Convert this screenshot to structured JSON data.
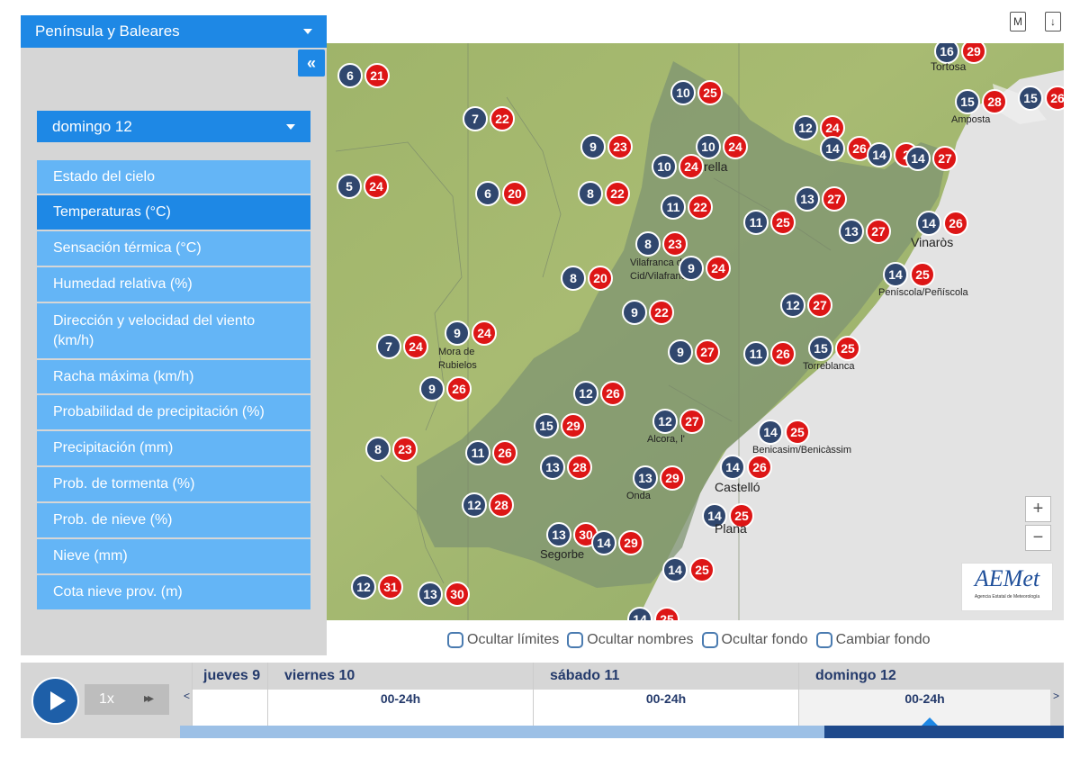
{
  "region": {
    "selected": "Península y Baleares"
  },
  "collapse_label": "«",
  "day_selector": {
    "selected": "domingo 12"
  },
  "menu": [
    {
      "label": "Estado del cielo",
      "active": false
    },
    {
      "label": "Temperaturas (°C)",
      "active": true
    },
    {
      "label": "Sensación térmica (°C)",
      "active": false
    },
    {
      "label": "Humedad relativa (%)",
      "active": false
    },
    {
      "label": "Dirección y velocidad del viento (km/h)",
      "active": false
    },
    {
      "label": "Racha máxima (km/h)",
      "active": false
    },
    {
      "label": "Probabilidad de precipitación (%)",
      "active": false
    },
    {
      "label": "Precipitación (mm)",
      "active": false
    },
    {
      "label": "Prob. de tormenta (%)",
      "active": false
    },
    {
      "label": "Prob. de nieve (%)",
      "active": false
    },
    {
      "label": "Nieve (mm)",
      "active": false
    },
    {
      "label": "Cota nieve prov. (m)",
      "active": false
    }
  ],
  "toolbar": {
    "pdf_icon": "M",
    "download_icon": "↓"
  },
  "map": {
    "zoom_in": "+",
    "zoom_out": "−",
    "logo_text": "AEMet",
    "logo_subtext": "Agencia Estatal de Meteorología",
    "stations": [
      {
        "min": "16",
        "max": "29",
        "label": "Tortosa"
      },
      {
        "min": "15",
        "max": "28",
        "label": "Amposta"
      },
      {
        "min": "15",
        "max": "26",
        "label": ""
      },
      {
        "min": "6",
        "max": "21",
        "label": ""
      },
      {
        "min": "10",
        "max": "25",
        "label": ""
      },
      {
        "min": "7",
        "max": "22",
        "label": ""
      },
      {
        "min": "12",
        "max": "24",
        "label": ""
      },
      {
        "min": "9",
        "max": "23",
        "label": ""
      },
      {
        "min": "10",
        "max": "24",
        "label": ""
      },
      {
        "min": "14",
        "max": "26",
        "label": ""
      },
      {
        "min": "14",
        "max": "2",
        "label": ""
      },
      {
        "min": "14",
        "max": "27",
        "label": ""
      },
      {
        "min": "10",
        "max": "24",
        "label": "rella"
      },
      {
        "min": "5",
        "max": "24",
        "label": ""
      },
      {
        "min": "6",
        "max": "20",
        "label": ""
      },
      {
        "min": "8",
        "max": "22",
        "label": ""
      },
      {
        "min": "13",
        "max": "27",
        "label": ""
      },
      {
        "min": "11",
        "max": "22",
        "label": ""
      },
      {
        "min": "11",
        "max": "25",
        "label": ""
      },
      {
        "min": "14",
        "max": "26",
        "label": "Vinaròs"
      },
      {
        "min": "13",
        "max": "27",
        "label": ""
      },
      {
        "min": "8",
        "max": "23",
        "label": "Vilafranca del Cid/Vilafranca"
      },
      {
        "min": "9",
        "max": "24",
        "label": ""
      },
      {
        "min": "14",
        "max": "25",
        "label": "Peníscola/Peñíscola"
      },
      {
        "min": "8",
        "max": "20",
        "label": ""
      },
      {
        "min": "12",
        "max": "27",
        "label": ""
      },
      {
        "min": "9",
        "max": "22",
        "label": ""
      },
      {
        "min": "9",
        "max": "24",
        "label": "Mora de Rubielos"
      },
      {
        "min": "7",
        "max": "24",
        "label": ""
      },
      {
        "min": "9",
        "max": "27",
        "label": ""
      },
      {
        "min": "11",
        "max": "26",
        "label": ""
      },
      {
        "min": "15",
        "max": "25",
        "label": "Torreblanca"
      },
      {
        "min": "9",
        "max": "26",
        "label": ""
      },
      {
        "min": "12",
        "max": "26",
        "label": ""
      },
      {
        "min": "15",
        "max": "29",
        "label": ""
      },
      {
        "min": "12",
        "max": "27",
        "label": "Alcora, l'"
      },
      {
        "min": "14",
        "max": "25",
        "label": "Benicasim/Benicàssim"
      },
      {
        "min": "8",
        "max": "23",
        "label": ""
      },
      {
        "min": "11",
        "max": "26",
        "label": ""
      },
      {
        "min": "13",
        "max": "28",
        "label": ""
      },
      {
        "min": "13",
        "max": "29",
        "label": "Onda"
      },
      {
        "min": "14",
        "max": "26",
        "label": "Castelló"
      },
      {
        "min": "12",
        "max": "28",
        "label": ""
      },
      {
        "min": "14",
        "max": "25",
        "label": "Plana"
      },
      {
        "min": "13",
        "max": "30",
        "label": "Segorbe"
      },
      {
        "min": "14",
        "max": "29",
        "label": ""
      },
      {
        "min": "14",
        "max": "25",
        "label": ""
      },
      {
        "min": "12",
        "max": "31",
        "label": ""
      },
      {
        "min": "13",
        "max": "30",
        "label": ""
      },
      {
        "min": "14",
        "max": "25",
        "label": ""
      }
    ]
  },
  "toggles": [
    {
      "label": "Ocultar límites"
    },
    {
      "label": "Ocultar nombres"
    },
    {
      "label": "Ocultar fondo"
    },
    {
      "label": "Cambiar fondo"
    }
  ],
  "player": {
    "speed": "1x",
    "fast_forward": "▸▸",
    "prev": "<",
    "next": ">"
  },
  "timeline": [
    {
      "day": "jueves 9",
      "range": ""
    },
    {
      "day": "viernes 10",
      "range": "00-24h"
    },
    {
      "day": "sábado 11",
      "range": "00-24h"
    },
    {
      "day": "domingo 12",
      "range": "00-24h"
    }
  ]
}
